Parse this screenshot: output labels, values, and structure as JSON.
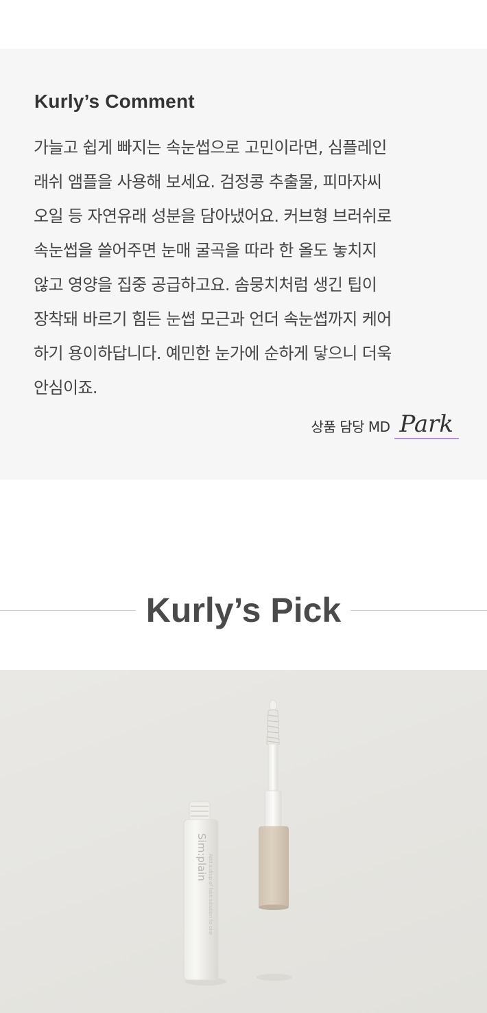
{
  "comment": {
    "title": "Kurly’s Comment",
    "lines": [
      "가늘고 쉽게 빠지는 속눈썹으로 고민이라면, 심플레인",
      "래쉬 앰플을 사용해 보세요. 검정콩 추출물, 피마자씨",
      "오일 등 자연유래 성분을 담아냈어요. 커브형 브러쉬로",
      "속눈썹을 쓸어주면 눈매 굴곡을 따라 한 올도 놓치지",
      "않고 영양을 집중 공급하고요. 솜뭉치처럼 생긴 팁이",
      "장착돼 바르기 힘든 눈썹 모근과 언더 속눈썹까지 케어",
      "하기 용이하답니다. 예민한 눈가에 순하게 닿으니 더욱",
      "안심이죠."
    ],
    "signature_label": "상품 담당 MD",
    "signature_name": "Park"
  },
  "pick": {
    "title": "Kurly’s Pick"
  },
  "product": {
    "brand": "Sim:plain",
    "tagline": "Add a drop of lash solution to one"
  },
  "colors": {
    "comment_bg": "#f6f6f6",
    "signature_underline": "#b490d8",
    "photo_bg": "#e6e5e1",
    "cap_color": "#d8ccbb"
  }
}
